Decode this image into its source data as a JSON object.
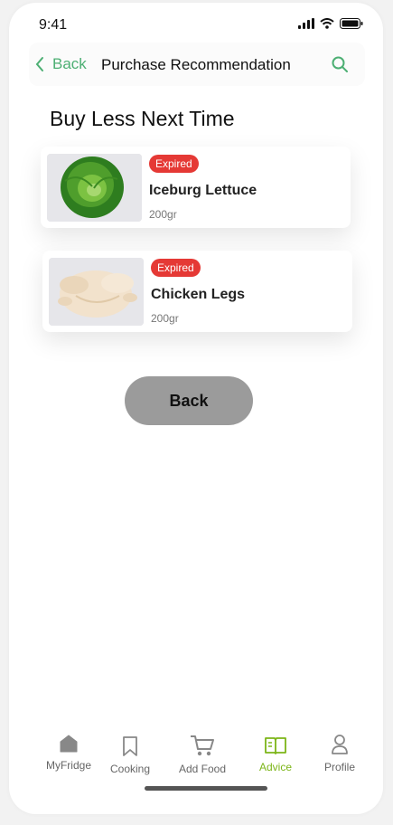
{
  "status": {
    "time": "9:41"
  },
  "nav": {
    "back_label": "Back",
    "title": "Purchase Recommendation"
  },
  "section": {
    "title": "Buy Less Next Time"
  },
  "items": [
    {
      "badge": "Expired",
      "name": "Iceburg Lettuce",
      "qty": "200gr"
    },
    {
      "badge": "Expired",
      "name": "Chicken Legs",
      "qty": "200gr"
    }
  ],
  "back_button": {
    "label": "Back"
  },
  "tabs": [
    {
      "label": "MyFridge",
      "icon": "home-icon"
    },
    {
      "label": "Cooking",
      "icon": "bookmark-icon"
    },
    {
      "label": "Add Food",
      "icon": "cart-icon"
    },
    {
      "label": "Advice",
      "icon": "book-icon",
      "active": true
    },
    {
      "label": "Profile",
      "icon": "user-icon"
    }
  ],
  "colors": {
    "accent": "#4caf73",
    "badge": "#e53935",
    "active_tab": "#7cb518"
  }
}
